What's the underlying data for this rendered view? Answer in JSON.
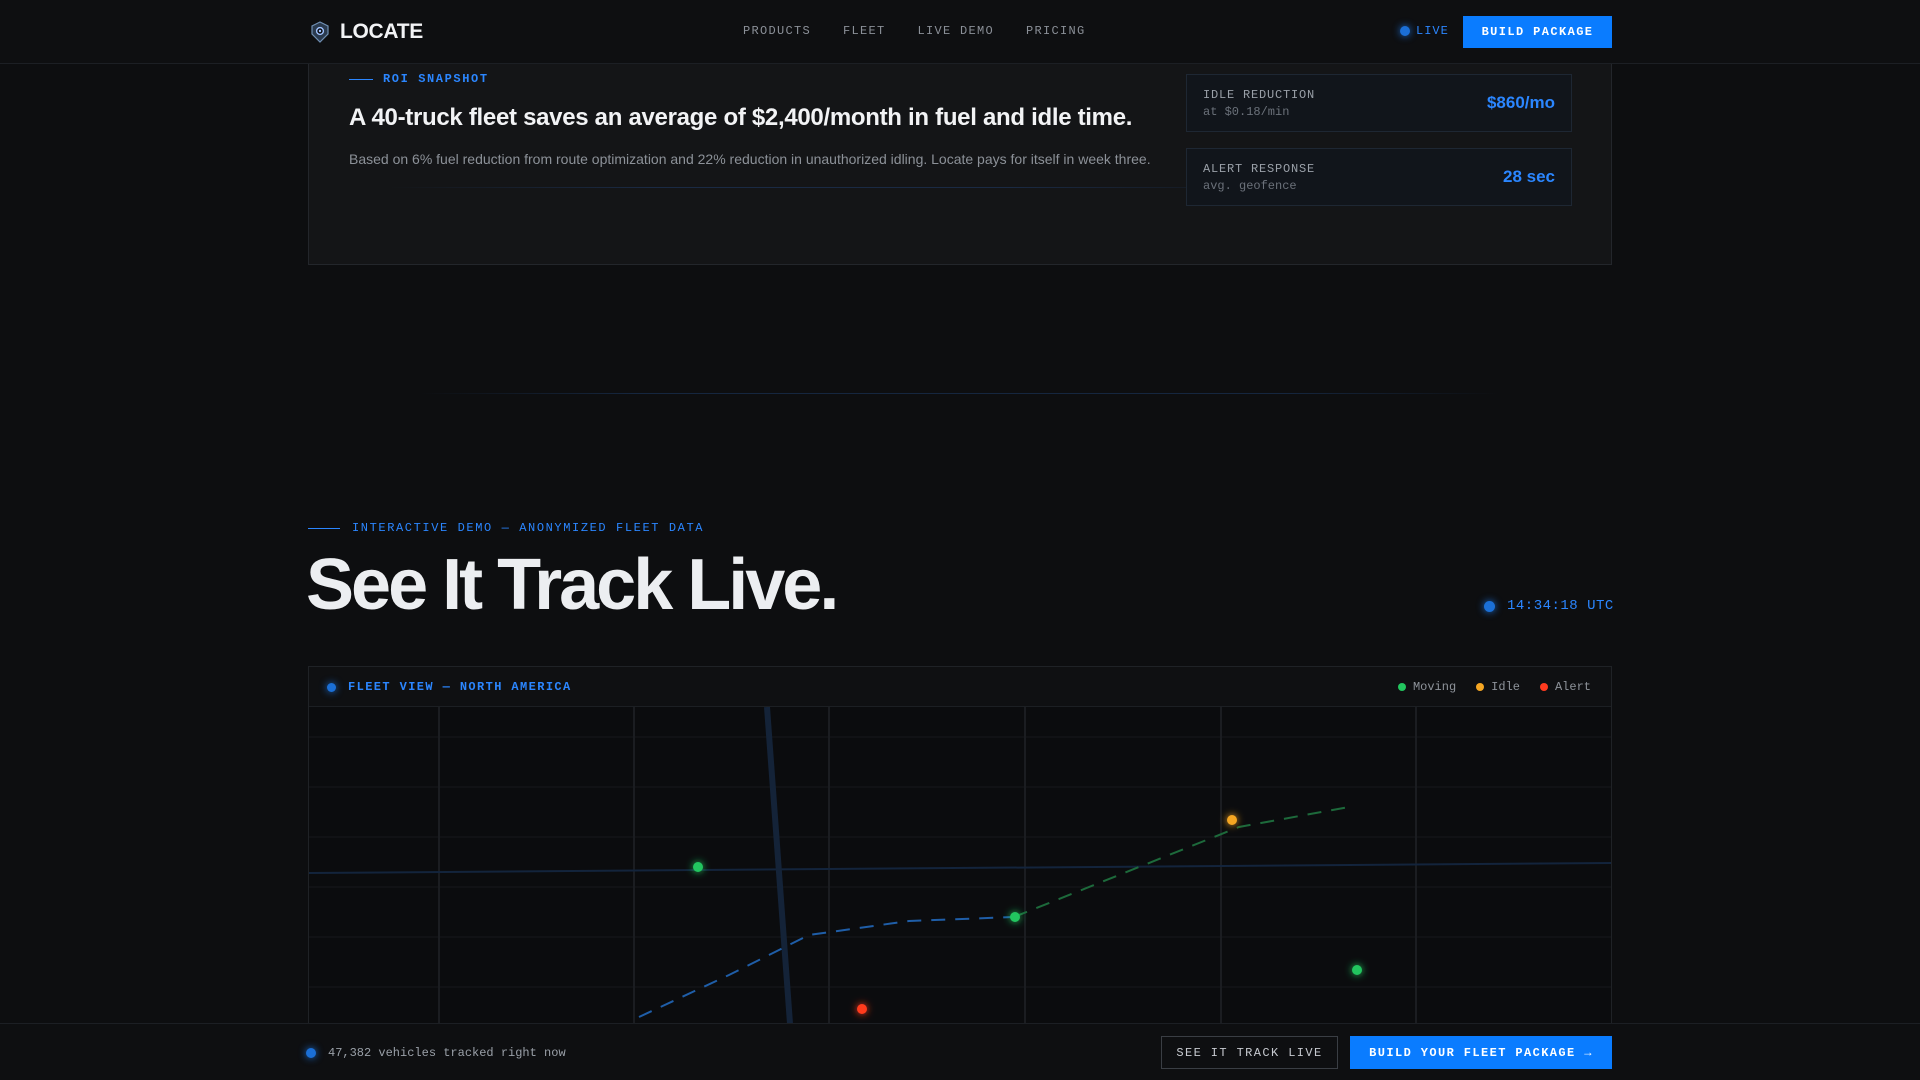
{
  "header": {
    "brand": "LOCATE",
    "nav": [
      "PRODUCTS",
      "FLEET",
      "LIVE DEMO",
      "PRICING"
    ],
    "live_label": "LIVE",
    "cta_label": "BUILD PACKAGE"
  },
  "roi": {
    "tag": "ROI SNAPSHOT",
    "headline": "A 40-truck fleet saves an average of $2,400/month in fuel and idle time.",
    "body": "Based on 6% fuel reduction from route optimization and 22% reduction in unauthorized idling. Locate pays for itself in week three.",
    "stats": [
      {
        "label": "IDLE REDUCTION",
        "sub": "at $0.18/min",
        "value": "$860/mo"
      },
      {
        "label": "ALERT RESPONSE",
        "sub": "avg. geofence",
        "value": "28 sec"
      }
    ]
  },
  "demo": {
    "tag": "INTERACTIVE DEMO — ANONYMIZED FLEET DATA",
    "title": "See It Track Live.",
    "clock": "14:34:18 UTC"
  },
  "map": {
    "title": "FLEET VIEW — NORTH AMERICA",
    "legend": [
      {
        "label": "Moving",
        "color": "#22c55e"
      },
      {
        "label": "Idle",
        "color": "#f5a623"
      },
      {
        "label": "Alert",
        "color": "#ff3b1f"
      }
    ],
    "icons": {
      "marker": "vehicle-marker",
      "dot": "status-dot"
    }
  },
  "footer": {
    "count_text": "47,382 vehicles tracked right now",
    "ghost_label": "SEE IT TRACK LIVE",
    "cta_label": "BUILD YOUR FLEET PACKAGE →"
  },
  "colors": {
    "accent": "#0a7cff",
    "accent_text": "#2b86ff",
    "moving": "#22c55e",
    "idle": "#f5a623",
    "alert": "#ff3b1f"
  }
}
